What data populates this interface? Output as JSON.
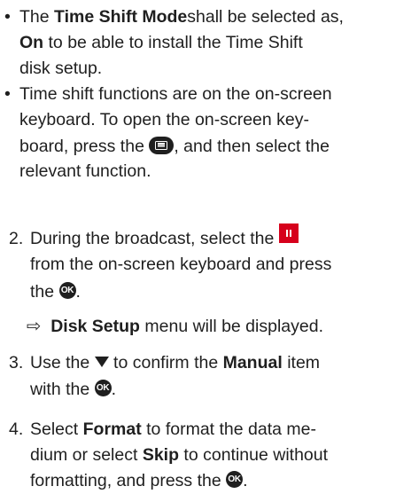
{
  "bullets": [
    {
      "marker": "•",
      "lines": [
        {
          "a": "The ",
          "b": "Time Shift Mode",
          "c": "shall be selected as,"
        },
        {
          "b": "On",
          "c": " to be able to install the Time Shift"
        },
        {
          "a": "disk setup."
        }
      ]
    },
    {
      "marker": "•",
      "lines": [
        {
          "a": "Time shift functions are on the on-screen"
        },
        {
          "a": "keyboard. To open the on-screen key-"
        },
        {
          "a": "board, press the ",
          "icon": "keyboard-icon",
          "c": ", and then select the"
        },
        {
          "a": "relevant function."
        }
      ]
    }
  ],
  "steps": [
    {
      "number": "2.",
      "lines": [
        {
          "a": "During the broadcast, select the ",
          "icon": "pause-icon"
        },
        {
          "a": "from the on-screen keyboard and press"
        },
        {
          "a": "the ",
          "icon": "ok-icon",
          "c": "."
        }
      ]
    },
    {
      "result_marker": "⇨",
      "result_bold": "Disk Setup",
      "result_text": " menu will be displayed."
    },
    {
      "number": "3.",
      "lines": [
        {
          "a": "Use the ",
          "icon": "down-arrow-icon",
          "b_pre": " to confirm the ",
          "b": "Manual",
          "c": " item"
        },
        {
          "a": "with the ",
          "icon": "ok-icon",
          "c": "."
        }
      ]
    },
    {
      "number": "4.",
      "lines": [
        {
          "a": "Select ",
          "b": "Format",
          "c": " to format the data me-"
        },
        {
          "a": "dium or select ",
          "b": "Skip",
          "c": "  to continue without"
        },
        {
          "a": "formatting, and press the ",
          "icon": "ok-icon",
          "c": "."
        }
      ]
    }
  ],
  "icons": {
    "ok_label": "OK"
  },
  "colors": {
    "text": "#1f1f1f",
    "pause_button": "#d6001c"
  }
}
